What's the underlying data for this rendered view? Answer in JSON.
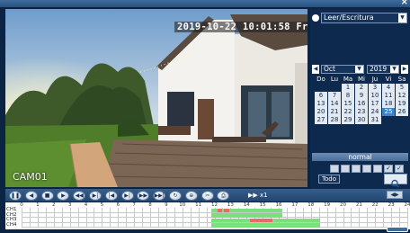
{
  "colors": {
    "panel_bg": "#0d2a4e",
    "selected_day": "#3f83c7",
    "rec_green": "#7be07b",
    "rec_red": "#e86a6a",
    "rec_yellow": "#e9e26a"
  },
  "video": {
    "timestamp": "2019-10-22 10:01:58 Fri",
    "camera_label": "CAM01"
  },
  "search_panel": {
    "mode_value": "Leer/Escritura",
    "month_value": "Oct",
    "year_value": "2019",
    "weekdays": [
      "Do",
      "Lu",
      "Ma",
      "Mi",
      "Ju",
      "Vi",
      "Sa"
    ],
    "weeks": [
      [
        "",
        "",
        "1",
        "2",
        "3",
        "4",
        "5"
      ],
      [
        "6",
        "7",
        "8",
        "9",
        "10",
        "11",
        "12"
      ],
      [
        "13",
        "14",
        "15",
        "16",
        "17",
        "18",
        "19"
      ],
      [
        "20",
        "21",
        "22",
        "23",
        "24",
        "25",
        "26"
      ],
      [
        "27",
        "28",
        "29",
        "30",
        "31",
        "",
        ""
      ]
    ],
    "selected_day": "25",
    "record_type": "normal",
    "channel_boxes": [
      "",
      "",
      "",
      "",
      "",
      "✓",
      "✓"
    ],
    "todo_label": "Todo"
  },
  "toolbar": {
    "buttons": [
      "pause-icon",
      "prev-icon",
      "stop-icon",
      "play-icon",
      "rewind-icon",
      "slow-icon",
      "frame-back-icon",
      "frame-fwd-icon",
      "fast-icon",
      "next-icon",
      "loop-icon",
      "zoom-icon",
      "clip-icon",
      "backup-icon"
    ],
    "speed_text": "x1"
  },
  "timeline": {
    "hours": [
      "0",
      "1",
      "2",
      "3",
      "4",
      "5",
      "6",
      "7",
      "8",
      "9",
      "10",
      "11",
      "12",
      "13",
      "14",
      "15",
      "16",
      "17",
      "18",
      "19",
      "20",
      "21",
      "22",
      "23",
      "24"
    ],
    "channels": [
      "CH1",
      "CH2",
      "CH3",
      "CH4"
    ],
    "recordings": [
      {
        "channel": 0,
        "start": 11.8,
        "end": 16.2,
        "type": "normal"
      },
      {
        "channel": 0,
        "start": 12.2,
        "end": 12.5,
        "type": "alarm"
      },
      {
        "channel": 0,
        "start": 12.6,
        "end": 12.9,
        "type": "alarm"
      },
      {
        "channel": 1,
        "start": 11.8,
        "end": 16.2,
        "type": "normal"
      },
      {
        "channel": 2,
        "start": 11.8,
        "end": 18.6,
        "type": "normal"
      },
      {
        "channel": 2,
        "start": 14.2,
        "end": 15.6,
        "type": "alarm"
      },
      {
        "channel": 3,
        "start": 11.8,
        "end": 18.6,
        "type": "normal"
      }
    ]
  }
}
